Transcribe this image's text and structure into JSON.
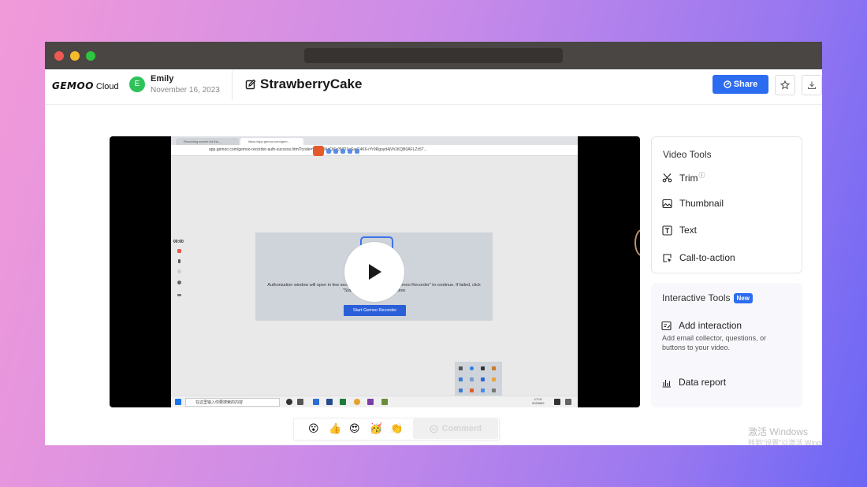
{
  "brand": {
    "logo_word": "GEMOO",
    "logo_suffix": "Cloud"
  },
  "user": {
    "initial": "E",
    "name": "Emily",
    "date": "November 16, 2023"
  },
  "video": {
    "title": "StrawberryCake"
  },
  "header_actions": {
    "share_label": "Share"
  },
  "recording": {
    "tab1": "Recording screen for the...",
    "tab2": "https://app.gemoo.com/gem...",
    "address": "app.gemoo.com/gemoo-recorder-auth-success.html?code=9%2F0AdQi6g3MD1pSad14K6-rYr9Rgoyd4jVh1KQB0AFLZx57...",
    "timer": "00:00",
    "dialog_text_line1": "Authorization window will open in few seconds. Please click \"Open Gemoo Recorder\" to continue. If failed, click",
    "dialog_text_line2": "\"Start Gemoo Recorder\" window",
    "dialog_button": "Start Gemoo Recorder",
    "taskbar_search": "在这里输入你要搜索的内容",
    "taskbar_time": "17:01",
    "taskbar_date": "2023/8/2"
  },
  "video_tools": {
    "title": "Video Tools",
    "items": [
      {
        "label": "Trim",
        "icon": "scissors-icon",
        "info": "ⓘ"
      },
      {
        "label": "Thumbnail",
        "icon": "image-icon"
      },
      {
        "label": "Text",
        "icon": "text-icon"
      },
      {
        "label": "Call-to-action",
        "icon": "cursor-icon"
      }
    ]
  },
  "interactive_tools": {
    "title": "Interactive Tools",
    "badge": "New",
    "add_interaction": "Add interaction",
    "add_interaction_desc": "Add email collector, questions, or buttons to your video.",
    "data_report": "Data report"
  },
  "reactions": [
    "😮",
    "👍",
    "😍",
    "🥳",
    "👏"
  ],
  "comment": {
    "label": "Comment"
  },
  "watermark": {
    "line1": "激活 Windows",
    "line2": "转到\"设置\"以激活 Windo"
  },
  "colors": {
    "accent": "#2c6cf0",
    "avatar": "#2ec25b"
  }
}
